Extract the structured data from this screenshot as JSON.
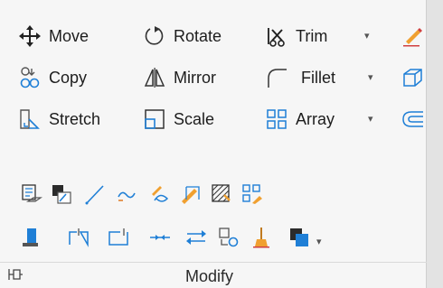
{
  "panel": {
    "title": "Modify",
    "row1": {
      "move": "Move",
      "rotate": "Rotate",
      "trim": "Trim"
    },
    "row2": {
      "copy": "Copy",
      "mirror": "Mirror",
      "fillet": "Fillet"
    },
    "row3": {
      "stretch": "Stretch",
      "scale": "Scale",
      "array": "Array"
    },
    "icons_row4": [
      "match-properties-icon",
      "copy-properties-icon",
      "lengthen-icon",
      "blend-curves-icon",
      "reverse-icon",
      "hatch-edit-icon",
      "array-edit-icon"
    ],
    "icons_row5": [
      "set-to-bylayer-icon",
      "break-at-point-icon",
      "break-icon",
      "join-icon",
      "reverse-direction-icon",
      "overkill-icon",
      "erase-icon",
      "draw-order-icon"
    ]
  },
  "colors": {
    "accent_blue": "#1f7fd6",
    "dark": "#2b2b2b",
    "orange": "#f0a030"
  }
}
